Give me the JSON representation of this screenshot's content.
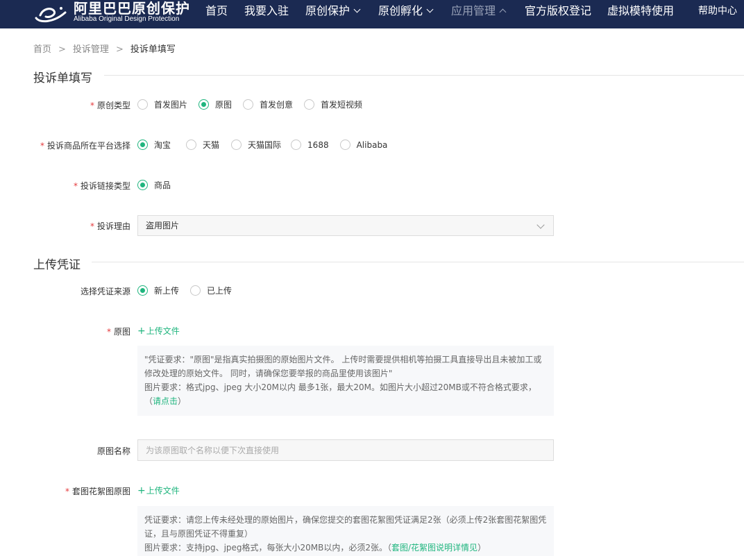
{
  "header": {
    "logo_cn": "阿里巴巴原创保护",
    "logo_en": "Alibaba Original Design Protection",
    "nav": [
      {
        "label": "首页"
      },
      {
        "label": "我要入驻"
      },
      {
        "label": "原创保护"
      },
      {
        "label": "原创孵化"
      },
      {
        "label": "应用管理"
      },
      {
        "label": "官方版权登记"
      },
      {
        "label": "虚拟模特使用"
      }
    ],
    "help": "帮助中心"
  },
  "breadcrumb": {
    "home": "首页",
    "mid": "投诉管理",
    "current": "投诉单填写",
    "sep": ">"
  },
  "form": {
    "section1_title": "投诉单填写",
    "required_mark": "*",
    "original_type": {
      "label": "原创类型",
      "options": [
        "首发图片",
        "原图",
        "首发创意",
        "首发短视频"
      ],
      "selected": "原图"
    },
    "platform": {
      "label": "投诉商品所在平台选择",
      "options": [
        "淘宝",
        "天猫",
        "天猫国际",
        "1688",
        "Alibaba"
      ],
      "selected": "淘宝"
    },
    "link_type": {
      "label": "投诉链接类型",
      "options": [
        "商品"
      ],
      "selected": "商品"
    },
    "reason": {
      "label": "投诉理由",
      "value": "盗用图片"
    },
    "section2_title": "上传凭证",
    "evidence_source": {
      "label": "选择凭证来源",
      "options": [
        "新上传",
        "已上传"
      ],
      "selected": "新上传"
    },
    "original_image": {
      "label": "原图",
      "upload": "上传文件",
      "note_line1": "\"凭证要求：\"原图\"是指真实拍摄图的原始图片文件。 上传时需要提供相机等拍摄工具直接导出且未被加工或修改处理的原始文件。 同时，请确保您要举报的商品里使用该图片\"",
      "note_line2": "图片要求：格式jpg、jpeg 大小20M以内 最多1张，最大20M。如图片大小超过20MB或不符合格式要求，（",
      "note_link": "请点击",
      "note_tail": "）"
    },
    "original_name": {
      "label": "原图名称",
      "placeholder": "为该原图取个名称以便下次直接使用"
    },
    "set_image": {
      "label": "套图花絮图原图",
      "upload": "上传文件",
      "note_line1": "凭证要求：请您上传未经处理的原始图片，确保您提交的套图花絮图凭证满足2张（必须上传2张套图花絮图凭证，且与原图凭证不得重复）",
      "note_line2": "图片要求：支持jpg、jpeg格式，每张大小20MB以内，必须2张。（",
      "note_link": "套图/花絮图说明详情见",
      "note_tail": "）"
    }
  },
  "colors": {
    "header_bg": "#1b2a52",
    "accent": "#1fb57e",
    "required": "#e4393c"
  }
}
